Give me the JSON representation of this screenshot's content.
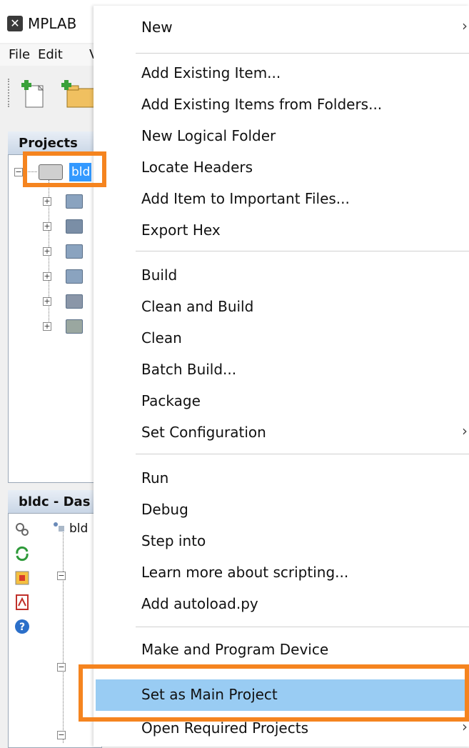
{
  "window": {
    "title": "MPLAB",
    "menu": [
      "File",
      "Edit",
      "V"
    ]
  },
  "projects_panel": {
    "tab_label": "Projects",
    "selected_project": "bld"
  },
  "dashboard_panel": {
    "tab_label": "bldc - Das",
    "tree_root": "bld"
  },
  "context_menu": {
    "items": [
      {
        "label": "New",
        "submenu": true
      },
      {
        "label": "Add Existing Item..."
      },
      {
        "label": "Add Existing Items from Folders..."
      },
      {
        "label": "New Logical Folder"
      },
      {
        "label": "Locate Headers"
      },
      {
        "label": "Add Item to Important Files..."
      },
      {
        "label": "Export Hex"
      },
      {
        "label": "Build"
      },
      {
        "label": "Clean and Build"
      },
      {
        "label": "Clean"
      },
      {
        "label": "Batch Build..."
      },
      {
        "label": "Package"
      },
      {
        "label": "Set Configuration",
        "submenu": true
      },
      {
        "label": "Run"
      },
      {
        "label": "Debug"
      },
      {
        "label": "Step into"
      },
      {
        "label": "Learn more about scripting..."
      },
      {
        "label": "Add autoload.py"
      },
      {
        "label": "Make and Program Device"
      },
      {
        "label": "Set as Main Project",
        "highlighted": true
      },
      {
        "label": "Open Required Projects",
        "submenu": true
      }
    ],
    "submenu_arrow": "›"
  },
  "colors": {
    "highlight": "#99ccf3",
    "annotation": "#f5841f",
    "selection": "#3399ff"
  }
}
